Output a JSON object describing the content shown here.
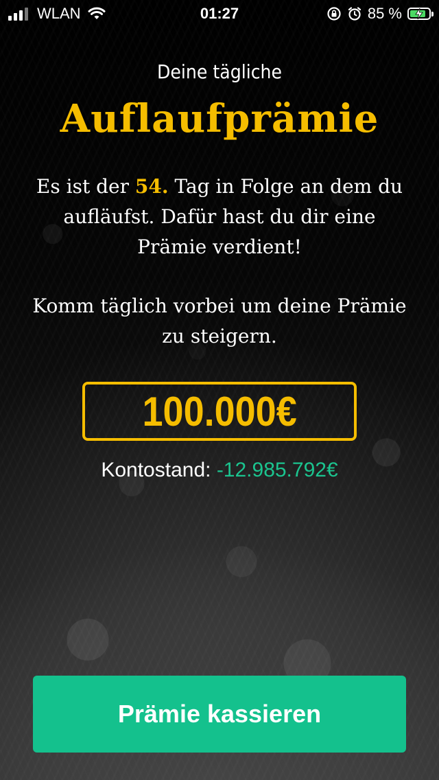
{
  "status_bar": {
    "carrier": "WLAN",
    "time": "01:27",
    "battery_percent": "85 %",
    "battery_level": 0.85,
    "charging": true
  },
  "reward": {
    "subtitle": "Deine tägliche",
    "title": "Auflaufprämie",
    "message_prefix": "Es ist der ",
    "streak_day": "54.",
    "message_suffix": " Tag in Folge an dem du aufläufst. Dafür hast du dir eine Prämie verdient!",
    "hint": "Komm täglich vorbei um deine Prämie zu steigern.",
    "amount": "100.000€",
    "balance_label": "Kontostand: ",
    "balance_value": "-12.985.792€",
    "cta_label": "Prämie kassieren"
  },
  "colors": {
    "accent_yellow": "#f5bd00",
    "accent_green": "#14c18d",
    "balance_green": "#1bc48f",
    "background": "#000000"
  },
  "icons": [
    "signal-icon",
    "wifi-icon",
    "rotation-lock-icon",
    "alarm-icon",
    "battery-charging-icon"
  ]
}
